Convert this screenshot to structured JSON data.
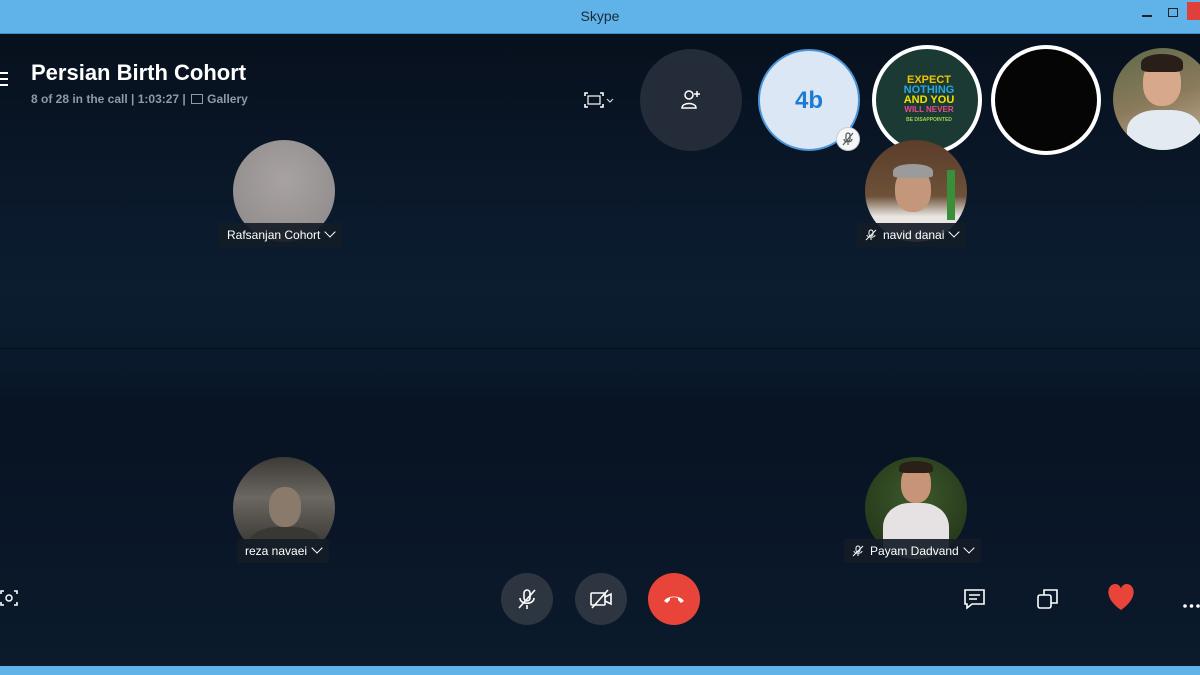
{
  "window": {
    "title": "Skype"
  },
  "call": {
    "title": "Persian Birth Cohort",
    "status": "8 of 28 in the call | 1:03:27 |",
    "view_label": "Gallery"
  },
  "thumbnails": [
    {
      "id": "4b",
      "label": "4b",
      "muted": true
    },
    {
      "id": "expect",
      "lines": [
        "EXPECT",
        "NOTHING",
        "AND YOU",
        "WILL NEVER",
        "BE DISAPPOINTED"
      ]
    },
    {
      "id": "black"
    },
    {
      "id": "man-photo"
    }
  ],
  "participants": [
    {
      "name": "Rafsanjan Cohort",
      "muted": false
    },
    {
      "name": "navid danai",
      "muted": true
    },
    {
      "name": "reza navaei",
      "muted": false
    },
    {
      "name": "Payam Dadvand",
      "muted": true
    }
  ],
  "colors": {
    "titlebar": "#5fb3e8",
    "background": "#0a1628",
    "end_call": "#e8443a",
    "heart": "#e8443a",
    "accent": "#1d7bd1"
  },
  "icons": {
    "menu": "hamburger-icon",
    "screen_share": "screen-icon",
    "add_people": "add-person-icon",
    "snapshot": "camera-icon",
    "mute": "mic-off-icon",
    "video": "video-off-icon",
    "end_call": "end-call-icon",
    "chat": "chat-icon",
    "switch_view": "switch-view-icon",
    "react": "heart-icon",
    "more": "more-icon"
  }
}
